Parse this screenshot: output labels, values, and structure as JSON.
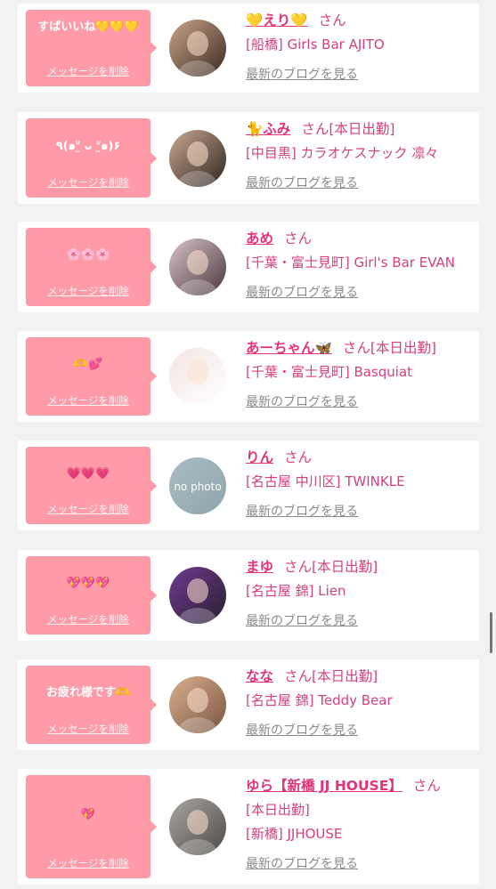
{
  "messages": [
    {
      "message": "すばいいね💛💛💛",
      "delete_label": "メッセージを削除",
      "avatar_icon": "user-photo",
      "name": "💛えり💛",
      "honorific": "さん",
      "status": "",
      "shop": "[船橋] Girls Bar AJITO",
      "blog_label": "最新のブログを見る"
    },
    {
      "message": "٩(๑ᐡ̤  ᴗ ᐡ̤๑)۶",
      "delete_label": "メッセージを削除",
      "avatar_icon": "user-photo",
      "name": "🐈ふみ",
      "honorific": "さん",
      "status": "[本日出勤]",
      "shop": "[中目黒] カラオケスナック 凛々",
      "blog_label": "最新のブログを見る"
    },
    {
      "message": "🌸🌸🌸",
      "delete_label": "メッセージを削除",
      "avatar_icon": "user-photo",
      "name": "あめ",
      "honorific": "さん",
      "status": "",
      "shop": "[千葉・富士見町] Girl's Bar EVAN",
      "blog_label": "最新のブログを見る"
    },
    {
      "message": "🫶💕",
      "delete_label": "メッセージを削除",
      "avatar_icon": "user-photo",
      "name": "あーちゃん🦋",
      "honorific": "さん",
      "status": "[本日出勤]",
      "shop": "[千葉・富士見町] Basquiat",
      "blog_label": "最新のブログを見る"
    },
    {
      "message": "💗💗💗",
      "delete_label": "メッセージを削除",
      "avatar_icon": "no-photo-placeholder",
      "avatar_text": "no photo",
      "name": "りん",
      "honorific": "さん",
      "status": "",
      "shop": "[名古屋 中川区] TWINKLE",
      "blog_label": "最新のブログを見る"
    },
    {
      "message": "💖💖💖",
      "delete_label": "メッセージを削除",
      "avatar_icon": "user-photo",
      "name": "まゆ",
      "honorific": "さん",
      "status": "[本日出勤]",
      "shop": "[名古屋 錦] Lien",
      "blog_label": "最新のブログを見る"
    },
    {
      "message": "お疲れ様です🫶",
      "delete_label": "メッセージを削除",
      "avatar_icon": "user-photo",
      "name": "なな",
      "honorific": "さん",
      "status": "[本日出勤]",
      "shop": "[名古屋 錦] Teddy Bear",
      "blog_label": "最新のブログを見る"
    },
    {
      "message": "💖",
      "delete_label": "メッセージを削除",
      "avatar_icon": "user-photo",
      "name": "ゆら【新橋 JJ HOUSE】",
      "honorific": "さん",
      "status": "[本日出勤]",
      "shop": "[新橋] JJHOUSE",
      "blog_label": "最新のブログを見る"
    }
  ],
  "colors": {
    "bubble": "#ff9aa9",
    "name": "#e3347a",
    "text": "#d6407d",
    "link_gray": "#8a8a8a",
    "background": "#f2f2f2"
  }
}
